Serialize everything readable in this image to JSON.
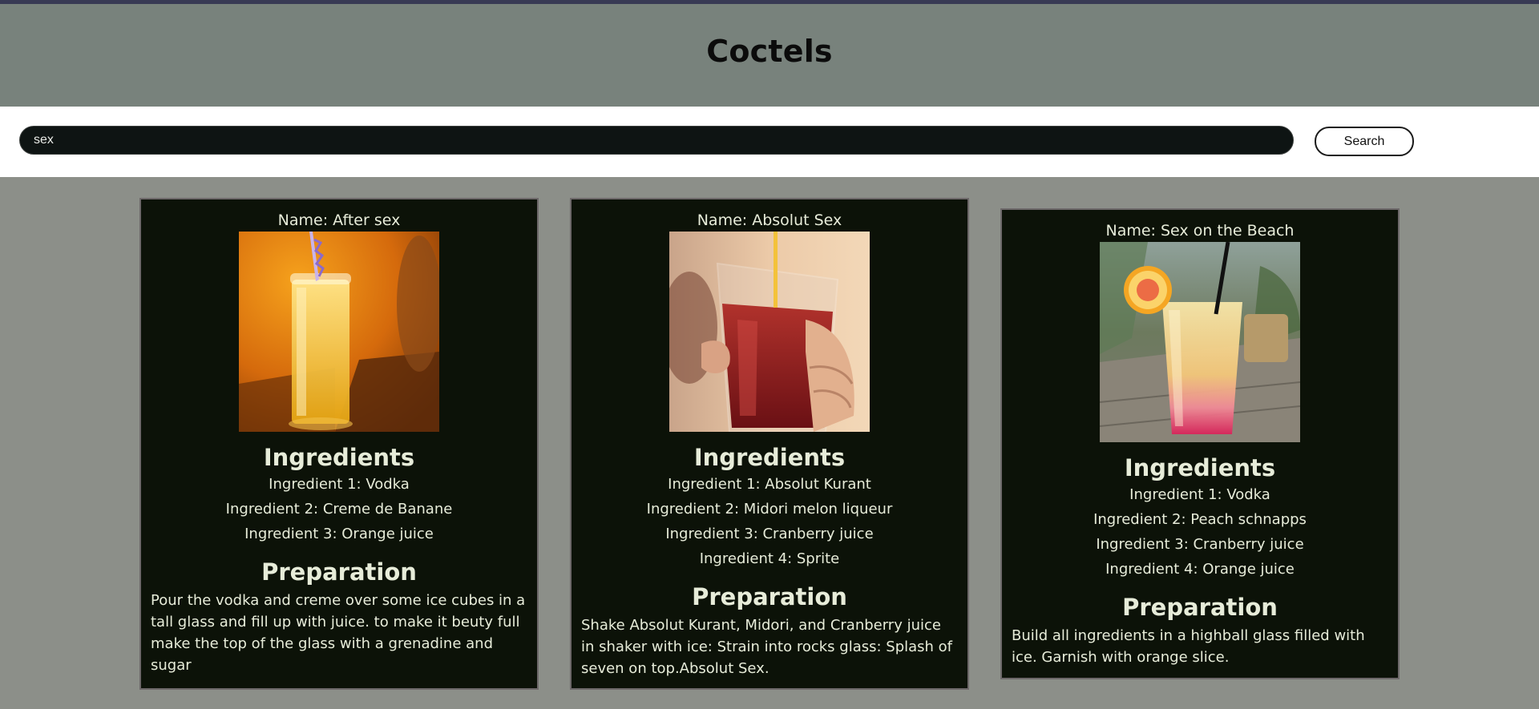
{
  "header": {
    "title": "Coctels"
  },
  "search": {
    "value": "sex",
    "button_label": "Search"
  },
  "cards": [
    {
      "name": "Name: After sex",
      "ingredients_title": "Ingredients",
      "ingredients": [
        "Ingredient 1: Vodka",
        "Ingredient 2: Creme de Banane",
        "Ingredient 3: Orange juice"
      ],
      "preparation_title": "Preparation",
      "preparation": "Pour the vodka and creme over some ice cubes in a tall glass and fill up with juice. to make it beuty full make the top of the glass with a grenadine and sugar"
    },
    {
      "name": "Name: Absolut Sex",
      "ingredients_title": "Ingredients",
      "ingredients": [
        "Ingredient 1: Absolut Kurant",
        "Ingredient 2: Midori melon liqueur",
        "Ingredient 3: Cranberry juice",
        "Ingredient 4: Sprite"
      ],
      "preparation_title": "Preparation",
      "preparation": "Shake Absolut Kurant, Midori, and Cranberry juice in shaker with ice: Strain into rocks glass: Splash of seven on top.Absolut Sex."
    },
    {
      "name": "Name: Sex on the Beach",
      "ingredients_title": "Ingredients",
      "ingredients": [
        "Ingredient 1: Vodka",
        "Ingredient 2: Peach schnapps",
        "Ingredient 3: Cranberry juice",
        "Ingredient 4: Orange juice"
      ],
      "preparation_title": "Preparation",
      "preparation": "Build all ingredients in a highball glass filled with ice. Garnish with orange slice."
    }
  ]
}
